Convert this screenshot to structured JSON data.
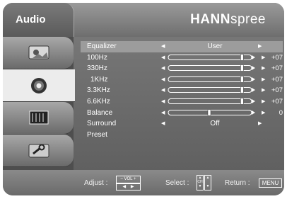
{
  "menu": {
    "tab_label": "Audio",
    "brand_bold": "HANN",
    "brand_light": "spree"
  },
  "sidebar": {
    "items": [
      {
        "icon": "picture-icon"
      },
      {
        "icon": "speaker-icon"
      },
      {
        "icon": "tv-screen-icon"
      },
      {
        "icon": "wrench-tool-icon"
      }
    ],
    "active_index": 1
  },
  "settings": [
    {
      "label": "Equalizer",
      "value": "User",
      "type": "option"
    },
    {
      "label": "100Hz",
      "value": "+07",
      "level": 0.9,
      "type": "slider"
    },
    {
      "label": "330Hz",
      "value": "+07",
      "level": 0.9,
      "type": "slider"
    },
    {
      "label": "1KHz",
      "value": "+07",
      "level": 0.9,
      "type": "slider"
    },
    {
      "label": "3.3KHz",
      "value": "+07",
      "level": 0.9,
      "type": "slider"
    },
    {
      "label": "6.6KHz",
      "value": "+07",
      "level": 0.9,
      "type": "slider"
    },
    {
      "label": "Balance",
      "value": "0",
      "level": 0.5,
      "type": "slider"
    },
    {
      "label": "Surround",
      "value": "Off",
      "type": "option"
    },
    {
      "label": "Preset",
      "type": "plain"
    }
  ],
  "footer": {
    "adjust_label": "Adjust :",
    "adjust_key": "VOL",
    "select_label": "Select :",
    "select_key": "CH",
    "return_label": "Return :",
    "return_key": "MENU"
  }
}
